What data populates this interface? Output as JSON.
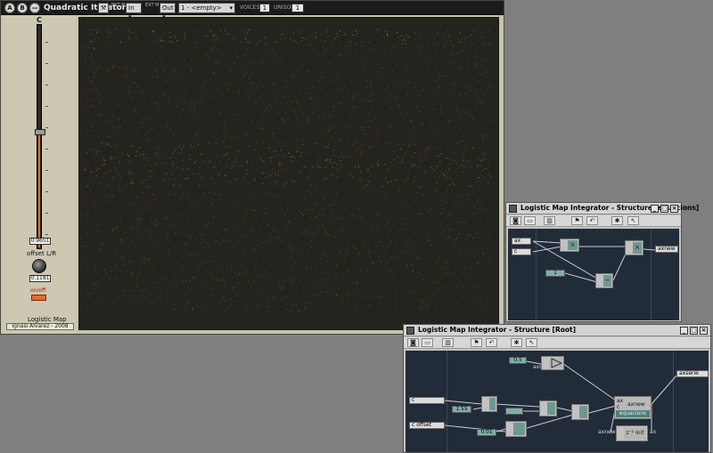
{
  "main_window": {
    "title": "Quadratic Iterator",
    "btn_a": "A",
    "btn_b": "B",
    "btn_minus": "—",
    "in_label": "In",
    "out_label": "Out",
    "ext_label": "EXT MIDI",
    "preset": "1 - <empty>",
    "voices_label": "VOICES",
    "voices_value": "1",
    "unison_label": "UNISON",
    "unison_value": "1",
    "c_label": "C",
    "c_value": "0.9651",
    "c_level": 0.52,
    "offset_label": "offset L/R",
    "offset_value": "0.1181",
    "onoff_label": "on/off",
    "patch_name": "Logistic Map",
    "author": "Ignasi Alvarez - 2008"
  },
  "equacions_window": {
    "title": "Logistic Map Integrator - Structure [equacions]",
    "port_in_ax": "ax",
    "port_in_c": "c",
    "const_1": "1",
    "port_out": "axnew",
    "mul_sign": "×",
    "minus_sign": "−"
  },
  "root_window": {
    "title": "Logistic Map Integrator - Structure [Root]",
    "const_05": "0.5",
    "label_axnew": "axnew",
    "port_c": "c",
    "port_c_offset": "c offset",
    "const_155": "1.55",
    "const_001": "0.01",
    "port_axserie": "axserie",
    "macro_name": "equacions",
    "macro_ax": "ax",
    "macro_c": "c",
    "macro_out": "axnew",
    "z1_in": "axnew",
    "z1_label": "z⁻¹ init",
    "z1_out": "ax"
  },
  "colors": {
    "display_bg": "#24241f",
    "dots_orange": "#d8742a",
    "dots_yellow": "#bfa63a",
    "canvas_bg": "#222b38",
    "node_fill": "#6f978f",
    "accent": "#e86a22"
  },
  "icons": [
    "wrench-icon",
    "camera-icon",
    "folder-icon",
    "module-icon",
    "flag-icon",
    "undo-icon",
    "bug-icon",
    "pointer-icon",
    "minimize-icon",
    "maximize-icon",
    "close-icon"
  ]
}
